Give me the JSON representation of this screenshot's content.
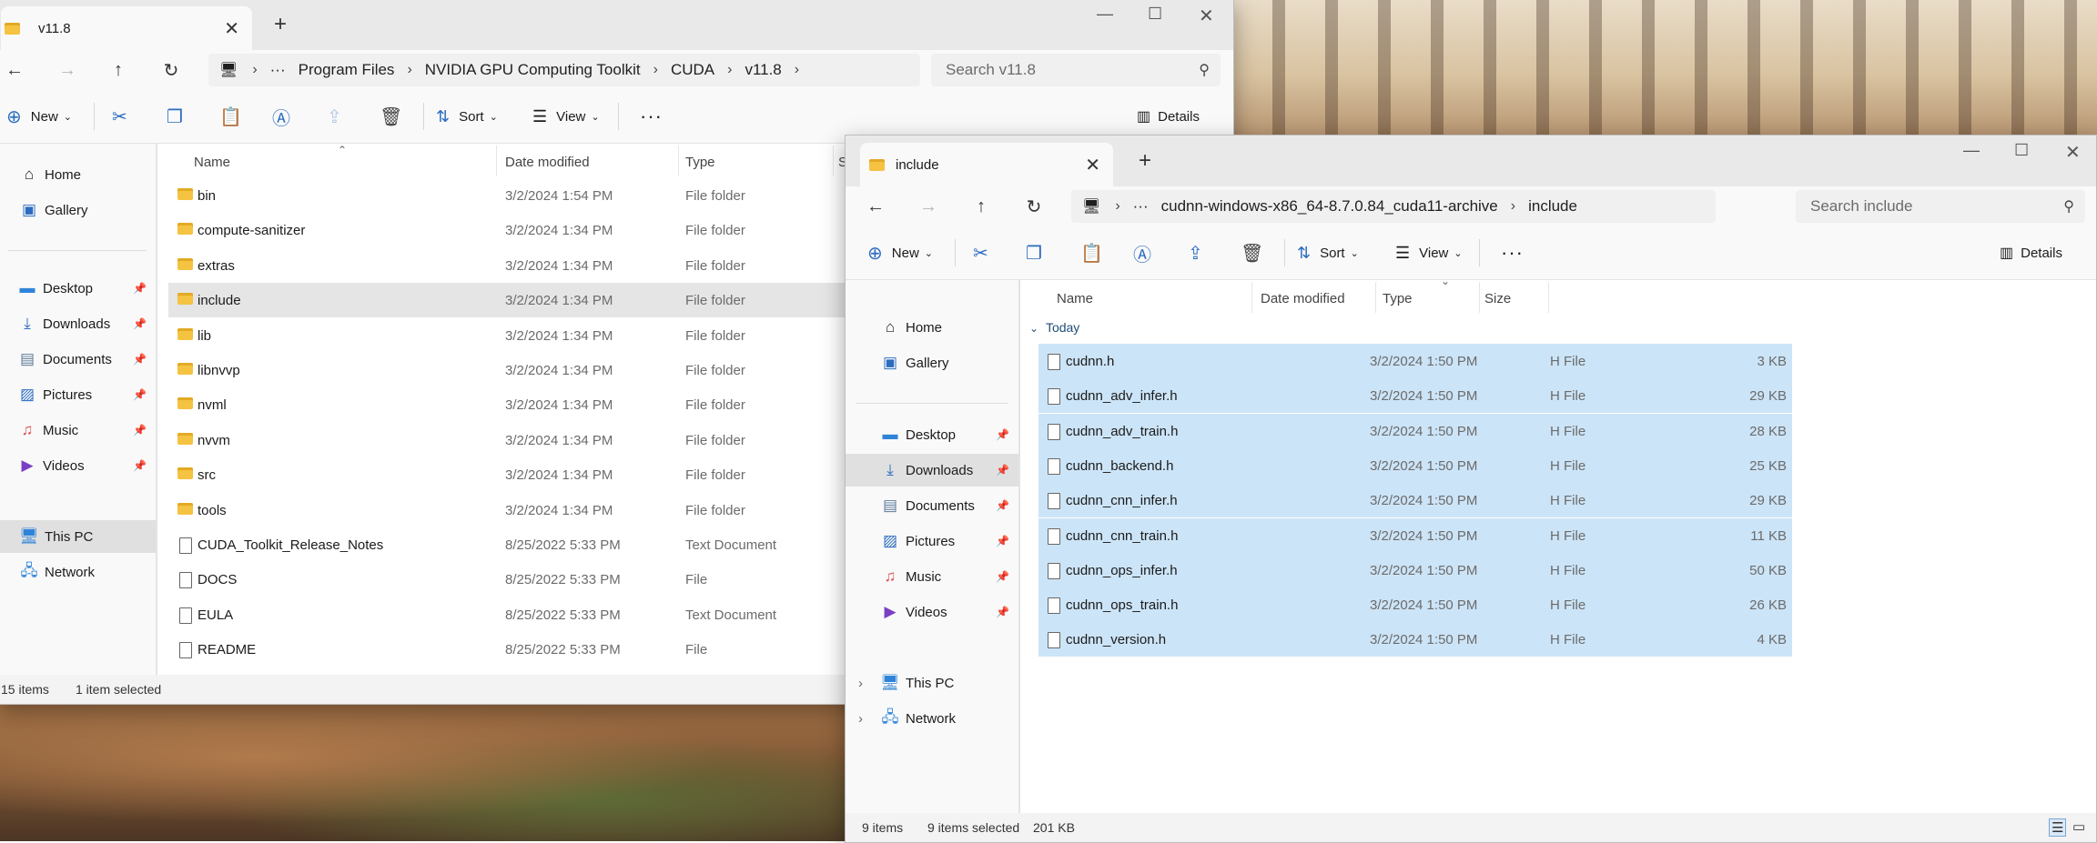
{
  "colors": {
    "accent": "#2b6cbf",
    "selection": "#cce4f7",
    "folder": "#f5c342"
  },
  "window1": {
    "tab_title": "v11.8",
    "new_tab": "+",
    "close_tab": "✕",
    "breadcrumb": [
      "Program Files",
      "NVIDIA GPU Computing Toolkit",
      "CUDA",
      "v11.8"
    ],
    "search_placeholder": "Search v11.8",
    "toolbar": {
      "new": "New",
      "sort": "Sort",
      "view": "View",
      "details": "Details"
    },
    "nav": {
      "home": "Home",
      "gallery": "Gallery",
      "desktop": "Desktop",
      "downloads": "Downloads",
      "documents": "Documents",
      "pictures": "Pictures",
      "music": "Music",
      "videos": "Videos",
      "this_pc": "This PC",
      "network": "Network"
    },
    "columns": {
      "name": "Name",
      "date": "Date modified",
      "type": "Type",
      "size": "S"
    },
    "rows": [
      {
        "name": "bin",
        "date": "3/2/2024 1:54 PM",
        "type": "File folder",
        "icon": "folder"
      },
      {
        "name": "compute-sanitizer",
        "date": "3/2/2024 1:34 PM",
        "type": "File folder",
        "icon": "folder"
      },
      {
        "name": "extras",
        "date": "3/2/2024 1:34 PM",
        "type": "File folder",
        "icon": "folder"
      },
      {
        "name": "include",
        "date": "3/2/2024 1:34 PM",
        "type": "File folder",
        "icon": "folder"
      },
      {
        "name": "lib",
        "date": "3/2/2024 1:34 PM",
        "type": "File folder",
        "icon": "folder"
      },
      {
        "name": "libnvvp",
        "date": "3/2/2024 1:34 PM",
        "type": "File folder",
        "icon": "folder"
      },
      {
        "name": "nvml",
        "date": "3/2/2024 1:34 PM",
        "type": "File folder",
        "icon": "folder"
      },
      {
        "name": "nvvm",
        "date": "3/2/2024 1:34 PM",
        "type": "File folder",
        "icon": "folder"
      },
      {
        "name": "src",
        "date": "3/2/2024 1:34 PM",
        "type": "File folder",
        "icon": "folder"
      },
      {
        "name": "tools",
        "date": "3/2/2024 1:34 PM",
        "type": "File folder",
        "icon": "folder"
      },
      {
        "name": "CUDA_Toolkit_Release_Notes",
        "date": "8/25/2022 5:33 PM",
        "type": "Text Document",
        "icon": "file"
      },
      {
        "name": "DOCS",
        "date": "8/25/2022 5:33 PM",
        "type": "File",
        "icon": "file"
      },
      {
        "name": "EULA",
        "date": "8/25/2022 5:33 PM",
        "type": "Text Document",
        "icon": "file"
      },
      {
        "name": "README",
        "date": "8/25/2022 5:33 PM",
        "type": "File",
        "icon": "file"
      }
    ],
    "status": {
      "count": "15 items",
      "selected": "1 item selected"
    }
  },
  "window2": {
    "tab_title": "include",
    "new_tab": "+",
    "close_tab": "✕",
    "breadcrumb": [
      "cudnn-windows-x86_64-8.7.0.84_cuda11-archive",
      "include"
    ],
    "search_placeholder": "Search include",
    "toolbar": {
      "new": "New",
      "sort": "Sort",
      "view": "View",
      "details": "Details"
    },
    "nav": {
      "home": "Home",
      "gallery": "Gallery",
      "desktop": "Desktop",
      "downloads": "Downloads",
      "documents": "Documents",
      "pictures": "Pictures",
      "music": "Music",
      "videos": "Videos",
      "this_pc": "This PC",
      "network": "Network"
    },
    "columns": {
      "name": "Name",
      "date": "Date modified",
      "type": "Type",
      "size": "Size"
    },
    "group": "Today",
    "rows": [
      {
        "name": "cudnn.h",
        "date": "3/2/2024 1:50 PM",
        "type": "H File",
        "size": "3 KB"
      },
      {
        "name": "cudnn_adv_infer.h",
        "date": "3/2/2024 1:50 PM",
        "type": "H File",
        "size": "29 KB"
      },
      {
        "name": "cudnn_adv_train.h",
        "date": "3/2/2024 1:50 PM",
        "type": "H File",
        "size": "28 KB"
      },
      {
        "name": "cudnn_backend.h",
        "date": "3/2/2024 1:50 PM",
        "type": "H File",
        "size": "25 KB"
      },
      {
        "name": "cudnn_cnn_infer.h",
        "date": "3/2/2024 1:50 PM",
        "type": "H File",
        "size": "29 KB"
      },
      {
        "name": "cudnn_cnn_train.h",
        "date": "3/2/2024 1:50 PM",
        "type": "H File",
        "size": "11 KB"
      },
      {
        "name": "cudnn_ops_infer.h",
        "date": "3/2/2024 1:50 PM",
        "type": "H File",
        "size": "50 KB"
      },
      {
        "name": "cudnn_ops_train.h",
        "date": "3/2/2024 1:50 PM",
        "type": "H File",
        "size": "26 KB"
      },
      {
        "name": "cudnn_version.h",
        "date": "3/2/2024 1:50 PM",
        "type": "H File",
        "size": "4 KB"
      }
    ],
    "status": {
      "count": "9 items",
      "selected": "9 items selected",
      "size": "201 KB"
    }
  }
}
